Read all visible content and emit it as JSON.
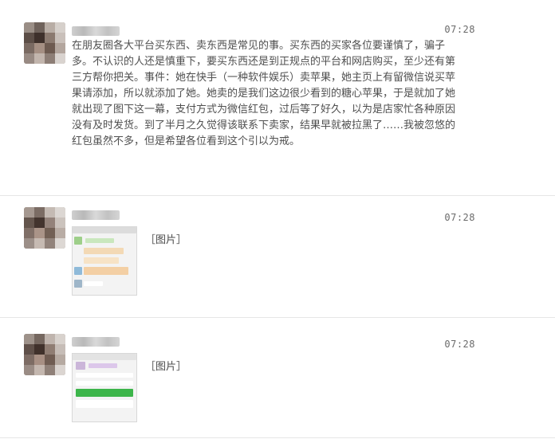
{
  "messages": [
    {
      "time": "07:28",
      "text": "在朋友圈各大平台买东西、卖东西是常见的事。买东西的买家各位要谨慎了，骗子多。不认识的人还是慎重下，要买东西还是到正规点的平台和网店购买，至少还有第三方帮你把关。事件：她在快手（一种软件娱乐）卖苹果，她主页上有留微信说买苹果请添加，所以就添加了她。她卖的是我们这边很少看到的糖心苹果，于是就加了她就出现了图下这一幕，支付方式为微信红包，过后等了好久，以为是店家忙各种原因没有及时发货。到了半月之久觉得该联系下卖家，结果早就被拉黑了……我被忽悠的红包虽然不多，但是希望各位看到这个引以为戒。"
    },
    {
      "time": "07:28",
      "image_label": "［图片］"
    },
    {
      "time": "07:28",
      "image_label": "［图片］"
    }
  ]
}
